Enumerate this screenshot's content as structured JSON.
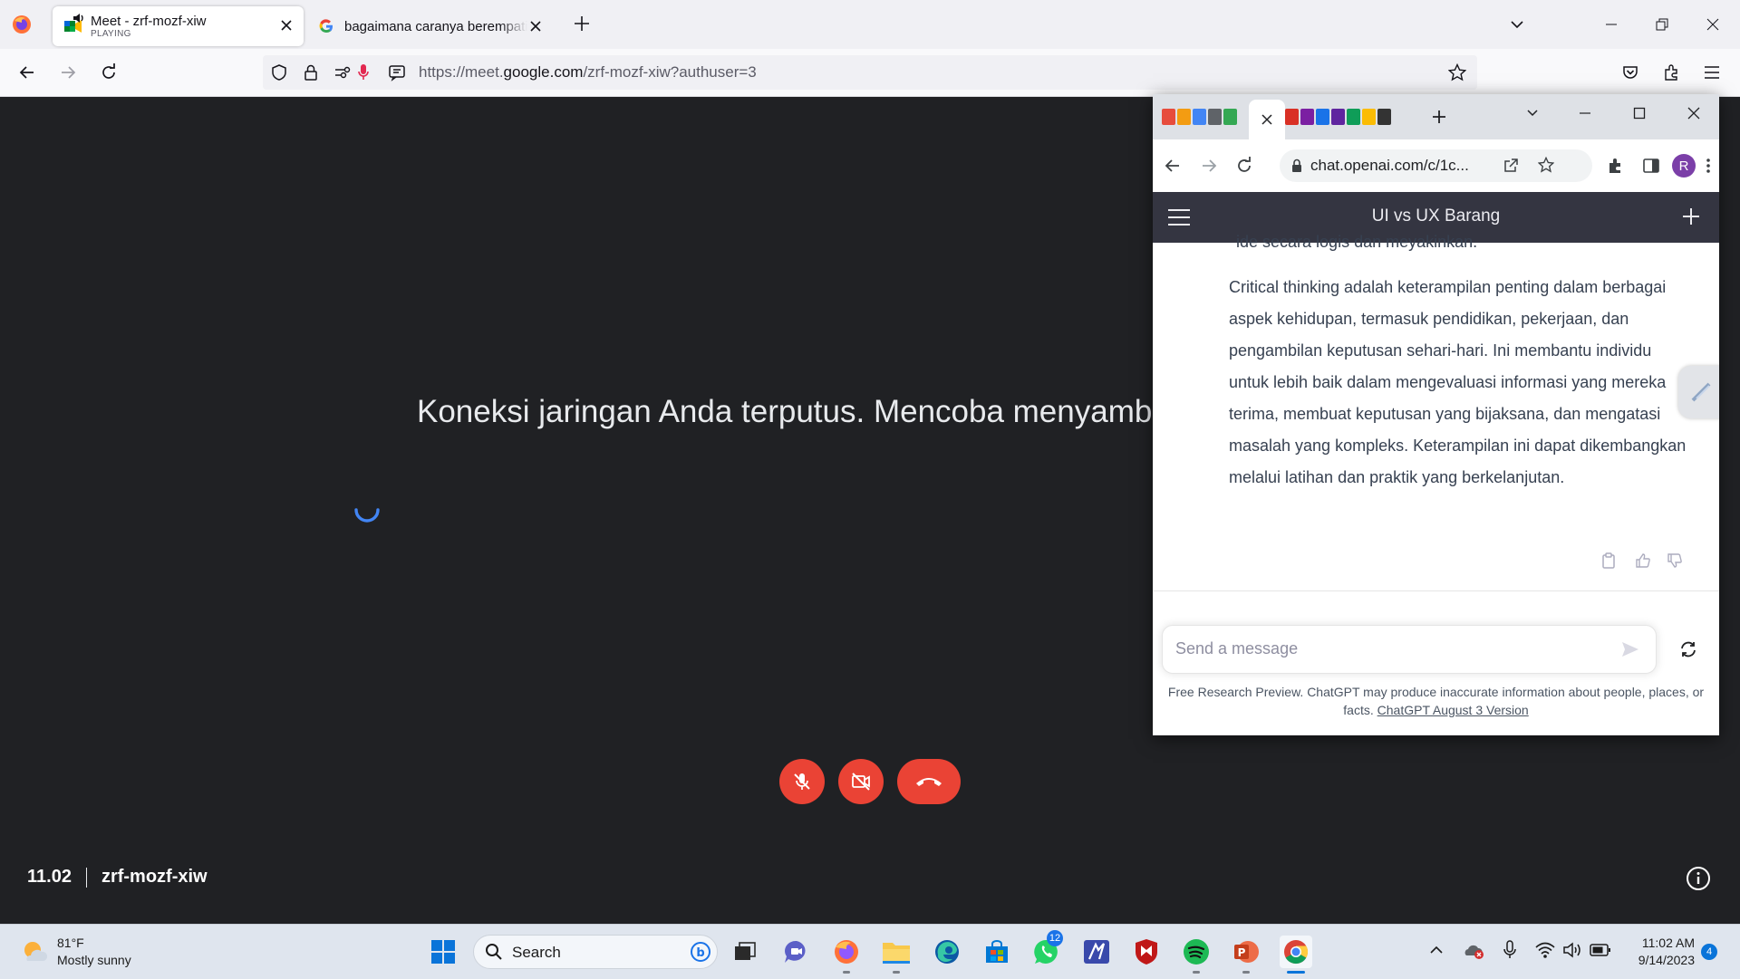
{
  "firefox": {
    "tabs": [
      {
        "title": "Meet - zrf-mozf-xiw",
        "subtitle": "PLAYING"
      },
      {
        "title": "bagaimana caranya berempati"
      }
    ],
    "url_prefix": "https://meet.",
    "url_domain": "google.com",
    "url_suffix": "/zrf-mozf-xiw?authuser=3"
  },
  "meet": {
    "status_message": "Koneksi jaringan Anda terputus. Mencoba menyamb",
    "time": "11.02",
    "meeting_code": "zrf-mozf-xiw",
    "colors": {
      "background": "#202124",
      "danger": "#ea4335"
    }
  },
  "chat_window": {
    "url": "chat.openai.com/c/1c...",
    "profile_initial": "R",
    "favicon_colors": [
      "#e74c3c",
      "#f39c12",
      "#4285f4",
      "#34a853",
      "#888",
      "#d93025",
      "#7b1fa2",
      "#1a73e8",
      "#5f259f",
      "#0f9d58",
      "#fbbc04",
      "#333"
    ],
    "conversation_title": "UI vs UX Barang",
    "cutoff_text": "ide secara logis dan meyakinkan.",
    "response": "Critical thinking adalah keterampilan penting dalam berbagai aspek kehidupan, termasuk pendidikan, pekerjaan, dan pengambilan keputusan sehari-hari. Ini membantu individu untuk lebih baik dalam mengevaluasi informasi yang mereka terima, membuat keputusan yang bijaksana, dan mengatasi masalah yang kompleks. Keterampilan ini dapat dikembangkan melalui latihan dan praktik yang berkelanjutan.",
    "input_placeholder": "Send a message",
    "footer_text": "Free Research Preview. ChatGPT may produce inaccurate information about people, places, or facts.",
    "footer_link": "ChatGPT August 3 Version"
  },
  "taskbar": {
    "weather_temp": "81°F",
    "weather_desc": "Mostly sunny",
    "search_label": "Search",
    "whatsapp_badge": "12",
    "clock_time": "11:02 AM",
    "clock_date": "9/14/2023",
    "notification_count": "4"
  }
}
